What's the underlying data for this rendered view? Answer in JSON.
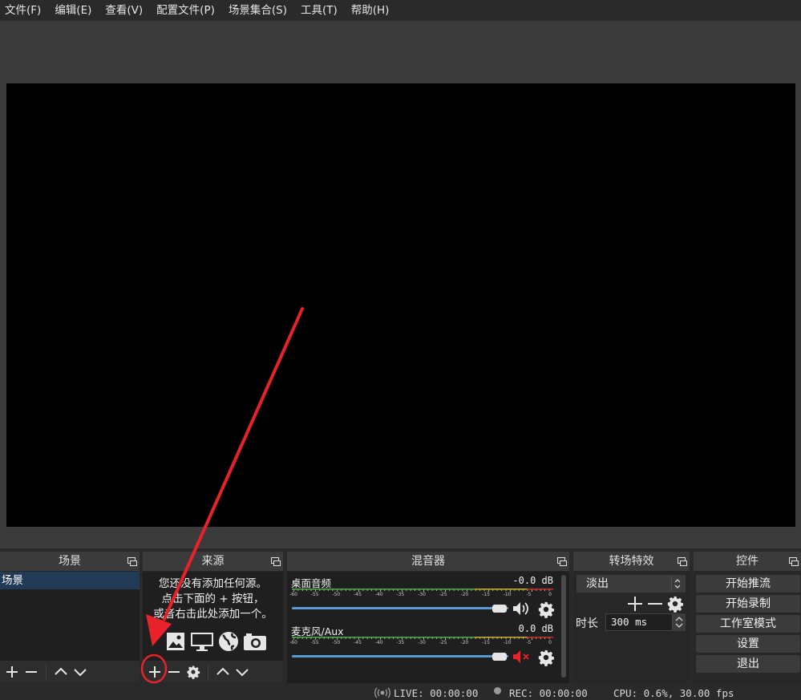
{
  "menu": [
    "文件(F)",
    "编辑(E)",
    "查看(V)",
    "配置文件(P)",
    "场景集合(S)",
    "工具(T)",
    "帮助(H)"
  ],
  "docks": {
    "scenes": {
      "title": "场景",
      "items": [
        "场景"
      ]
    },
    "sources": {
      "title": "来源",
      "empty_hint": [
        "您还没有添加任何源。",
        "点击下面的 + 按钮，",
        "或者右击此处添加一个。"
      ]
    },
    "mixer": {
      "title": "混音器",
      "scale": [
        "-60",
        "-55",
        "-50",
        "-45",
        "-40",
        "-35",
        "-30",
        "-25",
        "-20",
        "-15",
        "-10",
        "-5",
        "0"
      ],
      "channels": [
        {
          "name": "桌面音频",
          "db": "-0.0 dB",
          "muted": false,
          "volume_fraction": 0.98
        },
        {
          "name": "麦克风/Aux",
          "db": "0.0 dB",
          "muted": true,
          "volume_fraction": 0.98
        }
      ]
    },
    "transitions": {
      "title": "转场特效",
      "selected": "淡出",
      "duration_label": "时长",
      "duration_value": "300 ms"
    },
    "controls": {
      "title": "控件",
      "buttons": [
        "开始推流",
        "开始录制",
        "工作室模式",
        "设置",
        "退出"
      ]
    }
  },
  "status": {
    "live": "LIVE: 00:00:00",
    "rec": "REC: 00:00:00",
    "cpu": "CPU: 0.6%, 30.00 fps"
  },
  "colors": {
    "accent": "#5b9bd5",
    "annotation": "#e8212b",
    "meter_green": "#4cb04c",
    "meter_yellow": "#c8b428",
    "meter_red": "#c83228"
  },
  "icons": [
    "image-source-icon",
    "display-capture-icon",
    "browser-source-icon",
    "camera-source-icon",
    "gear-icon",
    "speaker-icon",
    "speaker-muted-icon",
    "float-dock-icon"
  ]
}
